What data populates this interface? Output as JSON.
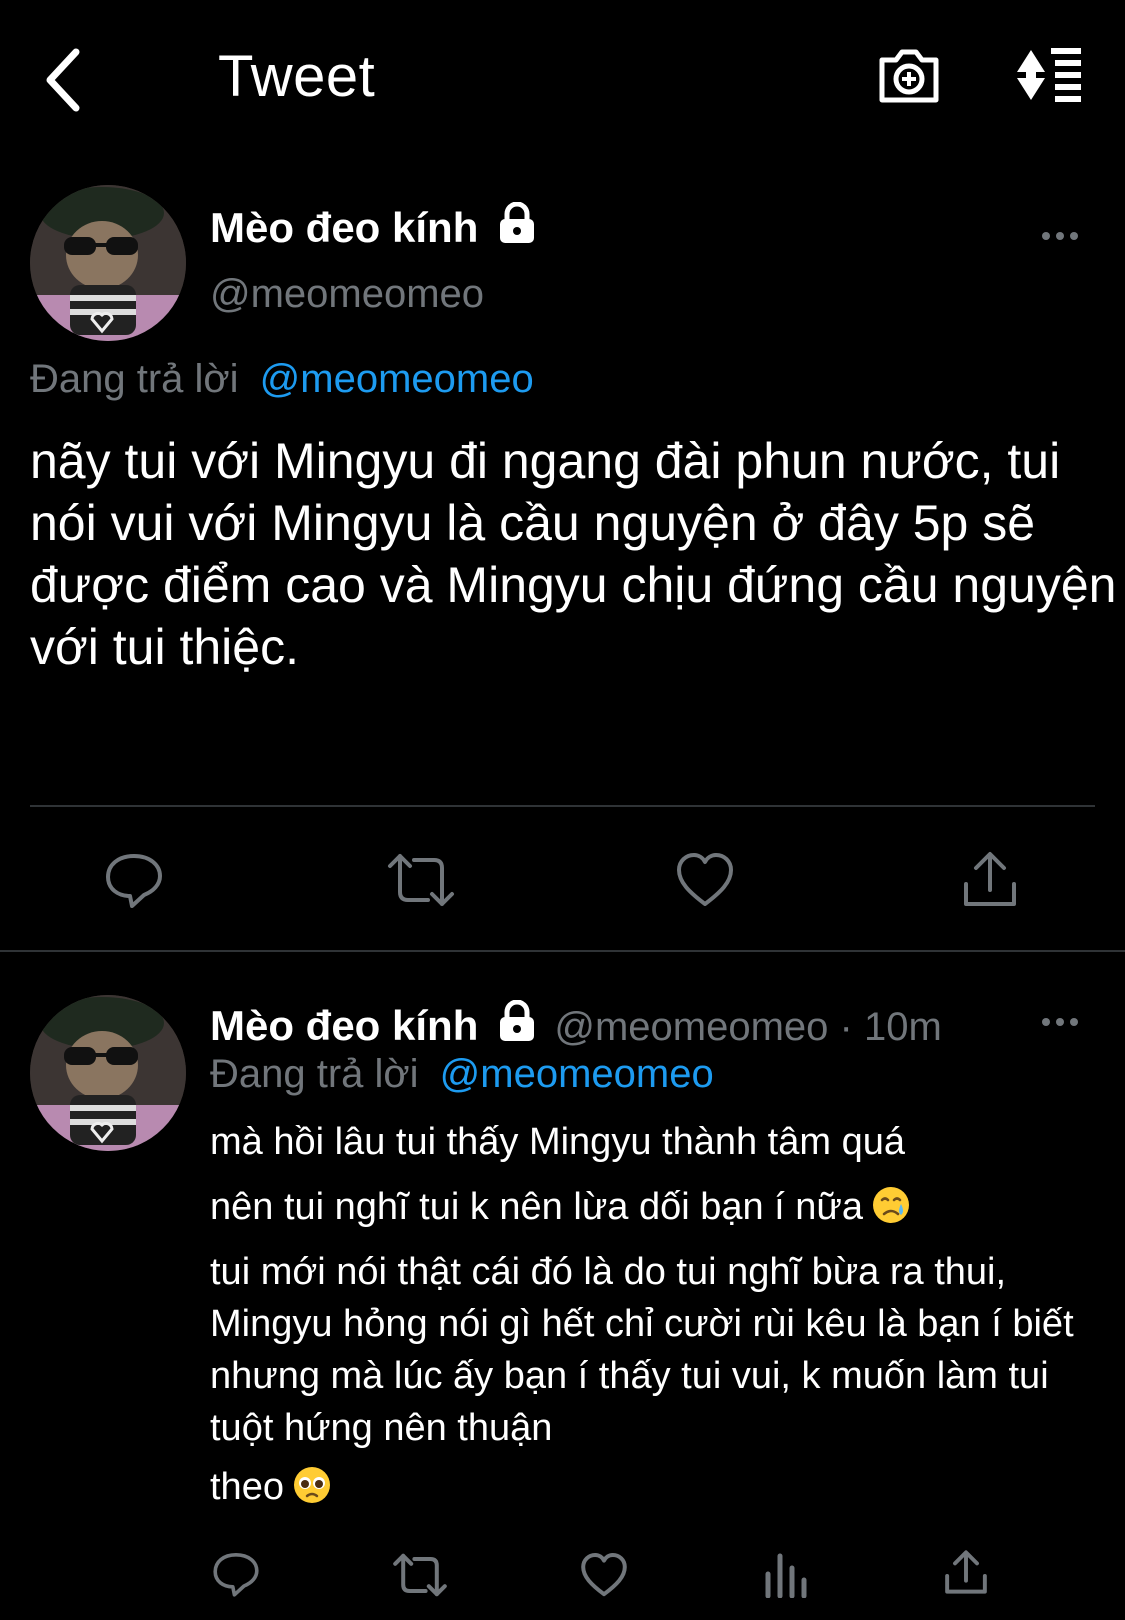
{
  "header": {
    "title": "Tweet"
  },
  "main_tweet": {
    "display_name": "Mèo đeo kính",
    "handle": "@meomeomeo",
    "replying_label": "Đang trả lời",
    "replying_to": "@meomeomeo",
    "text": "nãy tui với Mingyu đi ngang đài phun nước, tui nói vui với Mingyu là cầu nguyện ở đây 5p sẽ được điểm cao và Mingyu chịu đứng cầu nguyện với tui thiệc."
  },
  "reply_tweet": {
    "display_name": "Mèo đeo kính",
    "handle_time": "@meomeomeo · 10m",
    "replying_label": "Đang trả lời",
    "replying_to": "@meomeomeo",
    "lines": [
      "mà hồi lâu tui thấy Mingyu thành tâm quá",
      "nên tui nghĩ tui k nên lừa dối bạn í nữa",
      "tui mới nói thật cái đó là do tui nghĩ bừa ra thui, Mingyu hỏng nói gì hết chỉ cười rùi kêu là bạn í biết nhưng mà lúc ấy bạn í thấy tui vui, k muốn làm tui tuột hứng nên thuận",
      "theo"
    ],
    "emojis": [
      "crying-face",
      "pleading-face"
    ]
  },
  "colors": {
    "background": "#000000",
    "text": "#ffffff",
    "secondary": "#71767b",
    "link": "#1d9bf0",
    "divider": "#2f3336"
  },
  "icons": [
    "back-arrow-icon",
    "camera-plus-icon",
    "sort-icon",
    "lock-icon",
    "more-icon",
    "reply-icon",
    "retweet-icon",
    "like-icon",
    "analytics-icon",
    "share-icon"
  ]
}
